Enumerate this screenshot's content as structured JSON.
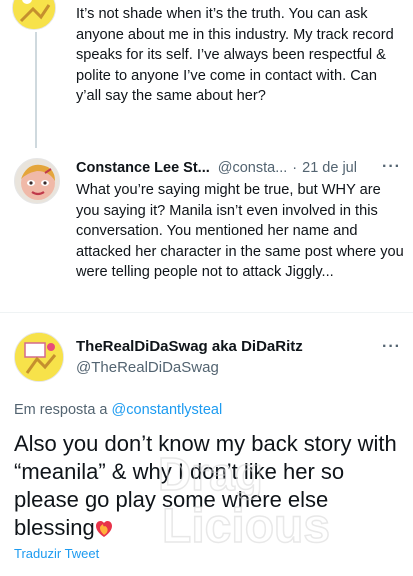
{
  "first_tweet": {
    "text": "It’s not shade when it’s the truth. You can ask anyone about me in this industry. My track record speaks for its self. I’ve always been respectful & polite to anyone I’ve come in contact with. Can y’all say the same about her?"
  },
  "second_tweet": {
    "author": "Constance Lee St...",
    "handle": "@consta...",
    "separator": "·",
    "date": "21 de jul",
    "more": "···",
    "text": "What you’re saying might be true, but WHY are you saying it? Manila isn’t even involved in this conversation. You mentioned her name and attacked her character in the same post where you were telling people not to attack Jiggly..."
  },
  "main_tweet": {
    "author": "TheRealDiDaSwag aka DiDaRitz",
    "handle": "@TheRealDiDaSwag",
    "more": "···",
    "reply_prefix": "Em resposta a",
    "reply_handle": "@constantlysteal",
    "text": "Also you don’t know my back story with “meanila” & why I don’t like her so please go play some where else blessing",
    "emoji": "❤️‍🔥",
    "translate": "Traduzir Tweet"
  },
  "watermark": {
    "line1": "Drag",
    "line2": "Licious"
  },
  "colors": {
    "text": "#0f1419",
    "secondary": "#536471",
    "link": "#1d9bf0",
    "avatar_yellow": "#f7e24a"
  },
  "icons": {
    "first_avatar": "avatar-image",
    "second_avatar": "avatar-image",
    "main_avatar": "avatar-image",
    "more": "more-options-icon"
  }
}
